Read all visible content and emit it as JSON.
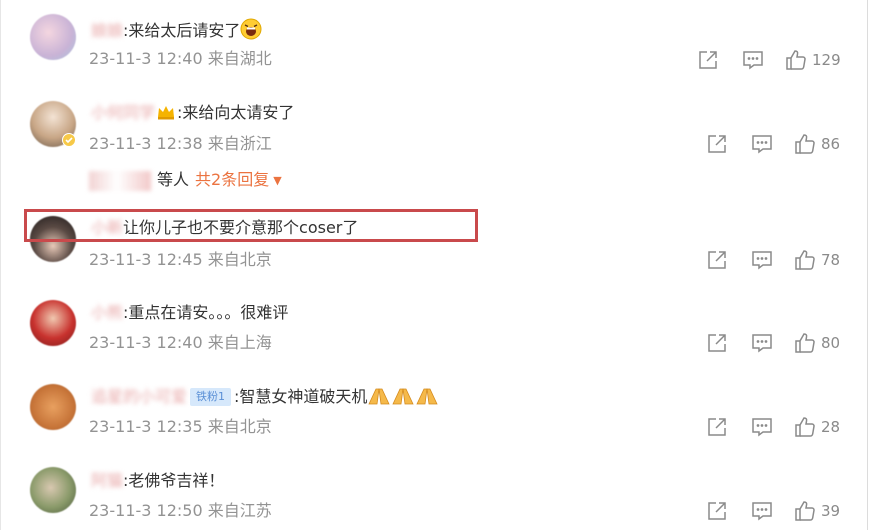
{
  "comments": [
    {
      "name": "娘娘",
      "text": ":来给太后请安了",
      "date": "23-11-3 12:40 来自湖北",
      "likes": "129"
    },
    {
      "name": "小何同学",
      "text": ":来给向太请安了",
      "date": "23-11-3 12:38 来自浙江",
      "likes": "86",
      "replies": {
        "text": "等人",
        "count_label": "共2条回复"
      }
    },
    {
      "name": "小新",
      "text": "让你儿子也不要介意那个coser了",
      "date": "23-11-3 12:45 来自北京",
      "likes": "78"
    },
    {
      "name": "小熊",
      "text": ":重点在请安。。。很难评",
      "date": "23-11-3 12:40 来自上海",
      "likes": "80"
    },
    {
      "name": "追星的小可爱",
      "fan_badge": "铁粉1",
      "text": ":智慧女神道破天机",
      "date": "23-11-3 12:35 来自北京",
      "likes": "28"
    },
    {
      "name": "阿猫",
      "text": ":老佛爷吉祥！",
      "date": "23-11-3 12:50 来自江苏",
      "likes": "39"
    }
  ],
  "colors": {
    "accent": "#eb7340",
    "highlight_box": "#c94a4c",
    "meta": "#939393"
  },
  "icons": [
    "share-icon",
    "comment-icon",
    "like-icon",
    "grinning-emoji",
    "praying-hands-emoji",
    "crown-icon",
    "verified-icon"
  ]
}
